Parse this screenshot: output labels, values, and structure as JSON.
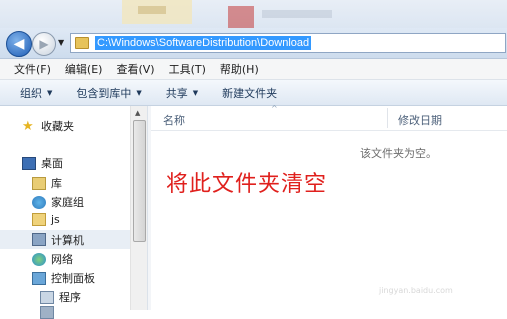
{
  "address": {
    "path": "C:\\Windows\\SoftwareDistribution\\Download"
  },
  "menu": [
    "文件(F)",
    "编辑(E)",
    "查看(V)",
    "工具(T)",
    "帮助(H)"
  ],
  "commands": [
    {
      "label": "组织",
      "has_arrow": true
    },
    {
      "label": "包含到库中",
      "has_arrow": true
    },
    {
      "label": "共享",
      "has_arrow": true
    },
    {
      "label": "新建文件夹",
      "has_arrow": false
    }
  ],
  "nav": {
    "favorites": "收藏夹",
    "desktop": "桌面",
    "library": "库",
    "homegroup": "家庭组",
    "js": "js",
    "computer": "计算机",
    "network": "网络",
    "control_panel": "控制面板",
    "programs": "程序"
  },
  "columns": {
    "name": "名称",
    "modified": "修改日期"
  },
  "empty_message": "该文件夹为空。",
  "annotation": "将此文件夹清空",
  "watermark": "jingyan.baidu.com",
  "colors": {
    "annotation": "#e0201d",
    "selection": "#3399ff"
  }
}
